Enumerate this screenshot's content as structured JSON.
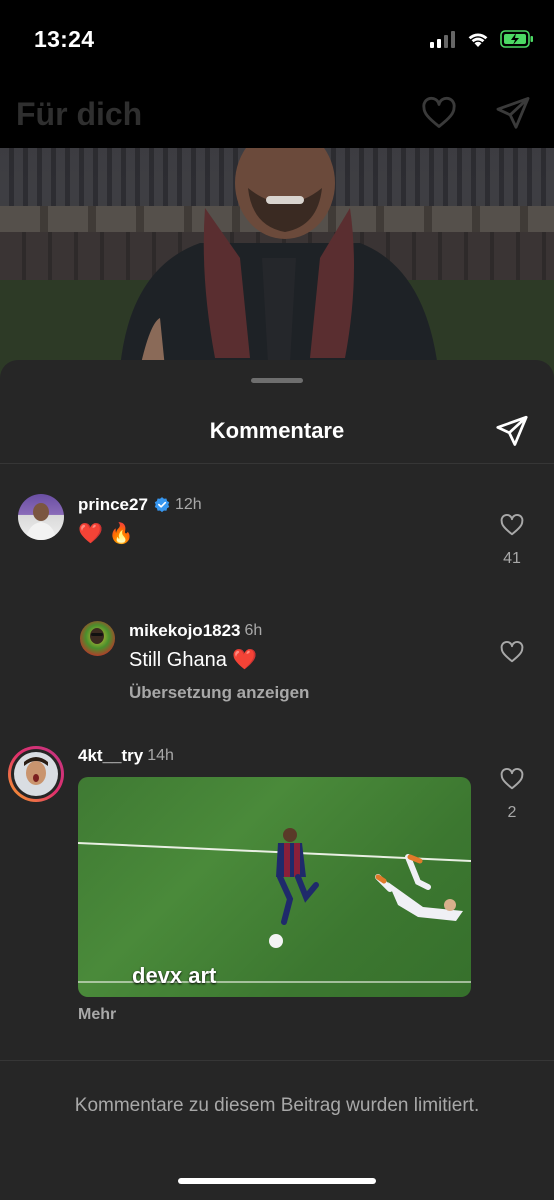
{
  "status_bar": {
    "time": "13:24",
    "icons": [
      "signal-icon",
      "wifi-icon",
      "battery-charging-icon"
    ],
    "battery_color": "#4cd964"
  },
  "header": {
    "title": "Für dich",
    "icons": [
      "heart-icon",
      "send-icon"
    ]
  },
  "comments_sheet": {
    "title": "Kommentare",
    "comments": [
      {
        "username": "prince27",
        "verified": true,
        "time": "12h",
        "text": "❤️ 🔥",
        "likes": "41"
      },
      {
        "username": "mikekojo1823",
        "time": "6h",
        "text": "Still Ghana ❤️",
        "translate": "Übersetzung anzeigen"
      },
      {
        "username": "4kt__try",
        "time": "14h",
        "gif_caption": "devx art",
        "likes": "2",
        "more": "Mehr"
      }
    ],
    "footer_note": "Kommentare zu diesem Beitrag wurden limitiert."
  },
  "colors": {
    "sheet_bg": "#262626",
    "secondary_text": "#a8a8a8",
    "verified_badge": "#3797f0",
    "heart_red": "#e0245e"
  }
}
